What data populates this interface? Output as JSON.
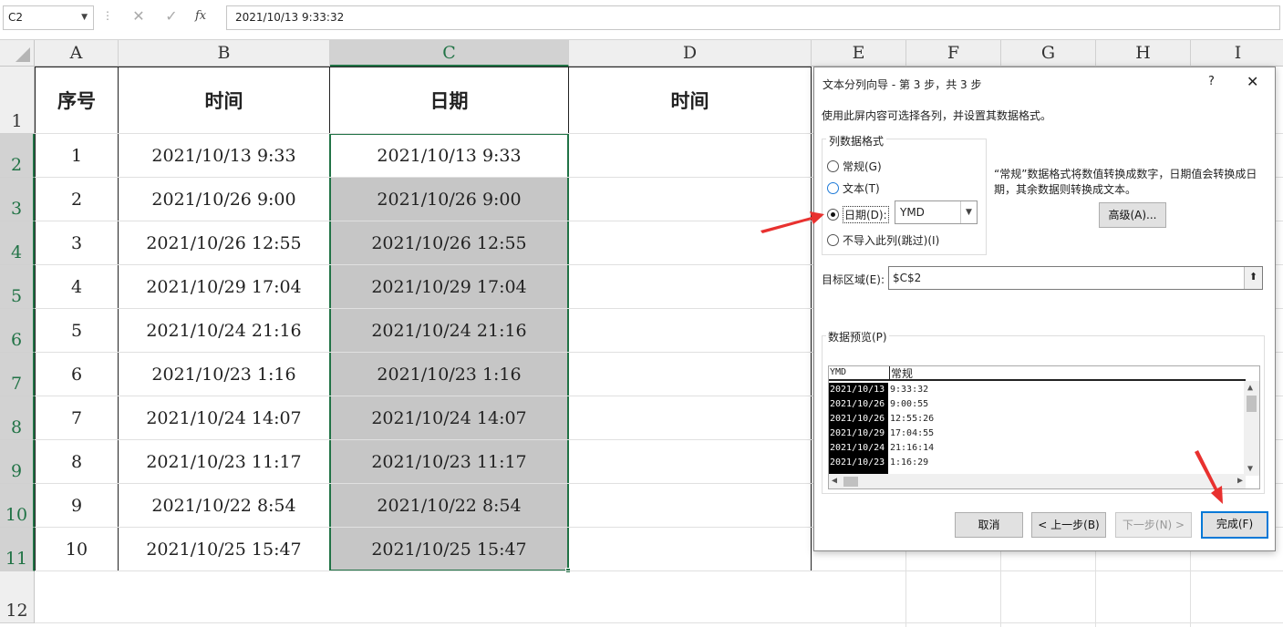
{
  "formula_bar": {
    "name_box": "C2",
    "name_box_dropdown": "chevron-down-icon",
    "cancel_icon": "✕",
    "enter_icon": "✓",
    "fx_label": "fx",
    "content": "2021/10/13  9:33:32"
  },
  "columns": [
    "A",
    "B",
    "C",
    "D",
    "E",
    "F",
    "G",
    "H",
    "I"
  ],
  "rows": [
    "1",
    "2",
    "3",
    "4",
    "5",
    "6",
    "7",
    "8",
    "9",
    "10",
    "11",
    "12"
  ],
  "table": {
    "headers": [
      "序号",
      "时间",
      "日期",
      "时间"
    ],
    "data": [
      [
        "1",
        "2021/10/13  9:33",
        "2021/10/13  9:33"
      ],
      [
        "2",
        "2021/10/26  9:00",
        "2021/10/26  9:00"
      ],
      [
        "3",
        "2021/10/26  12:55",
        "2021/10/26  12:55"
      ],
      [
        "4",
        "2021/10/29  17:04",
        "2021/10/29  17:04"
      ],
      [
        "5",
        "2021/10/24  21:16",
        "2021/10/24  21:16"
      ],
      [
        "6",
        "2021/10/23  1:16",
        "2021/10/23  1:16"
      ],
      [
        "7",
        "2021/10/24  14:07",
        "2021/10/24  14:07"
      ],
      [
        "8",
        "2021/10/23  11:17",
        "2021/10/23  11:17"
      ],
      [
        "9",
        "2021/10/22  8:54",
        "2021/10/22  8:54"
      ],
      [
        "10",
        "2021/10/25  15:47",
        "2021/10/25  15:47"
      ]
    ]
  },
  "dialog": {
    "title": "文本分列向导 - 第 3 步，共 3 步",
    "help": "?",
    "close": "✕",
    "instruction": "使用此屏内容可选择各列，并设置其数据格式。",
    "group_title": "列数据格式",
    "radio_general": "常规(G)",
    "radio_text": "文本(T)",
    "radio_date": "日期(D):",
    "radio_skip": "不导入此列(跳过)(I)",
    "date_format": "YMD",
    "note": "“常规”数据格式将数值转换成数字，日期值会转换成日期，其余数据则转换成文本。",
    "advanced_button": "高级(A)...",
    "target_label": "目标区域(E):",
    "target_value": "$C$2",
    "preview_title": "数据预览(P)",
    "preview_headers": [
      "YMD",
      "常规"
    ],
    "preview_col1": [
      "2021/10/13",
      "2021/10/26",
      "2021/10/26",
      "2021/10/29",
      "2021/10/24",
      "2021/10/23"
    ],
    "preview_col2": [
      "9:33:32",
      "9:00:55",
      "12:55:26",
      "17:04:55",
      "21:16:14",
      "1:16:29"
    ],
    "cancel_button": "取消",
    "back_button": "< 上一步(B)",
    "next_button": "下一步(N) >",
    "finish_button": "完成(F)"
  },
  "colors": {
    "accent_green": "#217346",
    "selection_grey": "#c6c6c6",
    "annotation_red": "#e8312f",
    "default_button_blue": "#0078d7"
  }
}
